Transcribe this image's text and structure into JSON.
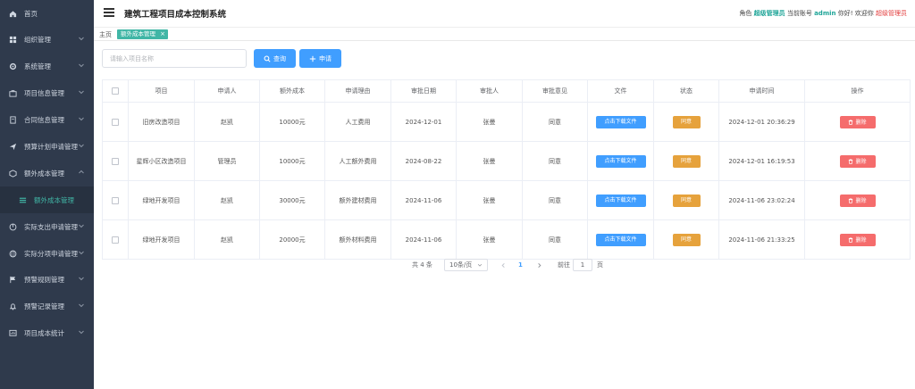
{
  "sidebar": {
    "items": [
      {
        "label": "首页",
        "icon": "home-icon"
      },
      {
        "label": "组织管理",
        "icon": "grid-icon"
      },
      {
        "label": "系统管理",
        "icon": "gear-icon"
      },
      {
        "label": "项目信息管理",
        "icon": "briefcase-icon"
      },
      {
        "label": "合同信息管理",
        "icon": "document-icon"
      },
      {
        "label": "预算计划申请管理",
        "icon": "send-icon"
      },
      {
        "label": "额外成本管理",
        "icon": "box-icon"
      },
      {
        "label": "额外成本管理",
        "icon": "list-icon",
        "active": true
      },
      {
        "label": "实际支出申请管理",
        "icon": "pie-icon"
      },
      {
        "label": "实际分项申请管理",
        "icon": "globe-icon"
      },
      {
        "label": "预警规则管理",
        "icon": "flag-icon"
      },
      {
        "label": "预警记录管理",
        "icon": "bell-icon"
      },
      {
        "label": "项目成本统计",
        "icon": "chart-icon"
      }
    ]
  },
  "header": {
    "title": "建筑工程项目成本控制系统",
    "role_prefix": "角色",
    "role": "超级管理员",
    "account_prefix": "当前账号",
    "account": "admin",
    "greeting": "你好! 欢迎你",
    "user": "超级管理员"
  },
  "tags": {
    "home": "主页",
    "active": "额外成本管理",
    "close": "×"
  },
  "search": {
    "placeholder": "请输入项目名称",
    "value": "",
    "query_label": "查询",
    "apply_label": "申请"
  },
  "table": {
    "columns": [
      "项目",
      "申请人",
      "额外成本",
      "申请理由",
      "审批日期",
      "审批人",
      "审批意见",
      "文件",
      "状态",
      "申请时间",
      "操作"
    ],
    "rows": [
      {
        "project": "旧房改造项目",
        "applicant": "赵凯",
        "cost": "10000元",
        "reason": "人工费用",
        "approve_date": "2024-12-01",
        "approver": "张曼",
        "opinion": "同意",
        "file": "点击下载文件",
        "status": "同意",
        "apply_time": "2024-12-01 20:36:29",
        "action": "删除"
      },
      {
        "project": "星辉小区改造项目",
        "applicant": "管理员",
        "cost": "10000元",
        "reason": "人工额外费用",
        "approve_date": "2024-08-22",
        "approver": "张曼",
        "opinion": "同意",
        "file": "点击下载文件",
        "status": "同意",
        "apply_time": "2024-12-01 16:19:53",
        "action": "删除"
      },
      {
        "project": "绿地开发项目",
        "applicant": "赵凯",
        "cost": "30000元",
        "reason": "额外建材费用",
        "approve_date": "2024-11-06",
        "approver": "张曼",
        "opinion": "同意",
        "file": "点击下载文件",
        "status": "同意",
        "apply_time": "2024-11-06 23:02:24",
        "action": "删除"
      },
      {
        "project": "绿地开发项目",
        "applicant": "赵凯",
        "cost": "20000元",
        "reason": "额外材料费用",
        "approve_date": "2024-11-06",
        "approver": "张曼",
        "opinion": "同意",
        "file": "点击下载文件",
        "status": "同意",
        "apply_time": "2024-11-06 21:33:25",
        "action": "删除"
      }
    ]
  },
  "pagination": {
    "total": "共 4 条",
    "page_size": "10条/页",
    "current": "1",
    "goto_label": "前往",
    "goto_value": "1",
    "unit": "页"
  },
  "colors": {
    "sidebar_bg": "#2f3a4c",
    "accent": "#41b6a6",
    "primary": "#409eff",
    "warning": "#e6a23c",
    "danger": "#f56c6c"
  }
}
